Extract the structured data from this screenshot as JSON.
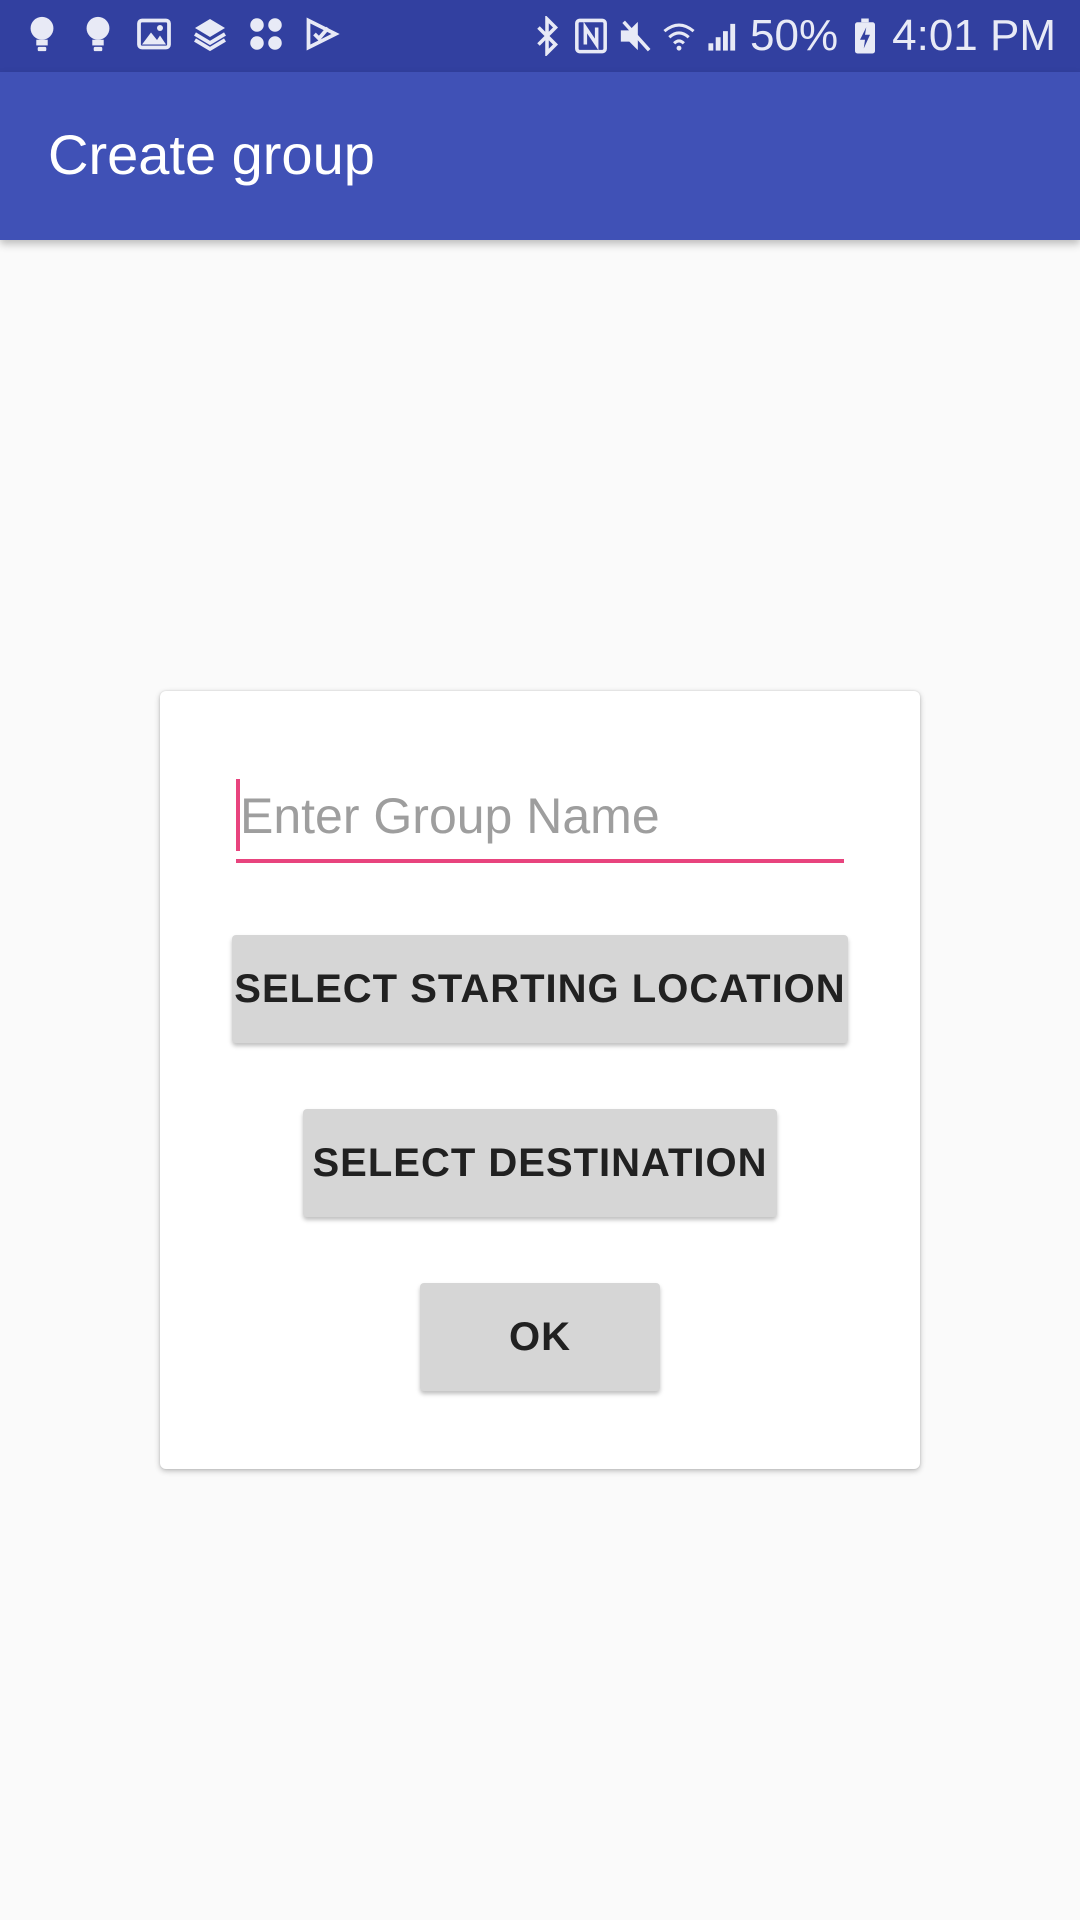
{
  "status_bar": {
    "left_icons": [
      "bulb-icon",
      "bulb-icon",
      "image-icon",
      "layers-icon",
      "app-grid-icon",
      "checkmark-icon"
    ],
    "right_icons": [
      "bluetooth-icon",
      "nfc-icon",
      "mute-icon",
      "wifi-icon",
      "signal-icon",
      "battery-charging-icon"
    ],
    "battery": "50%",
    "time": "4:01 PM"
  },
  "app_bar": {
    "title": "Create group",
    "color": "#4051b6"
  },
  "dialog": {
    "group_name_input": {
      "value": "",
      "placeholder": "Enter Group Name",
      "accent_color": "#e8447e"
    },
    "buttons": {
      "start_location": "SELECT STARTING LOCATION",
      "destination": "SELECT DESTINATION",
      "ok": "OK"
    }
  }
}
